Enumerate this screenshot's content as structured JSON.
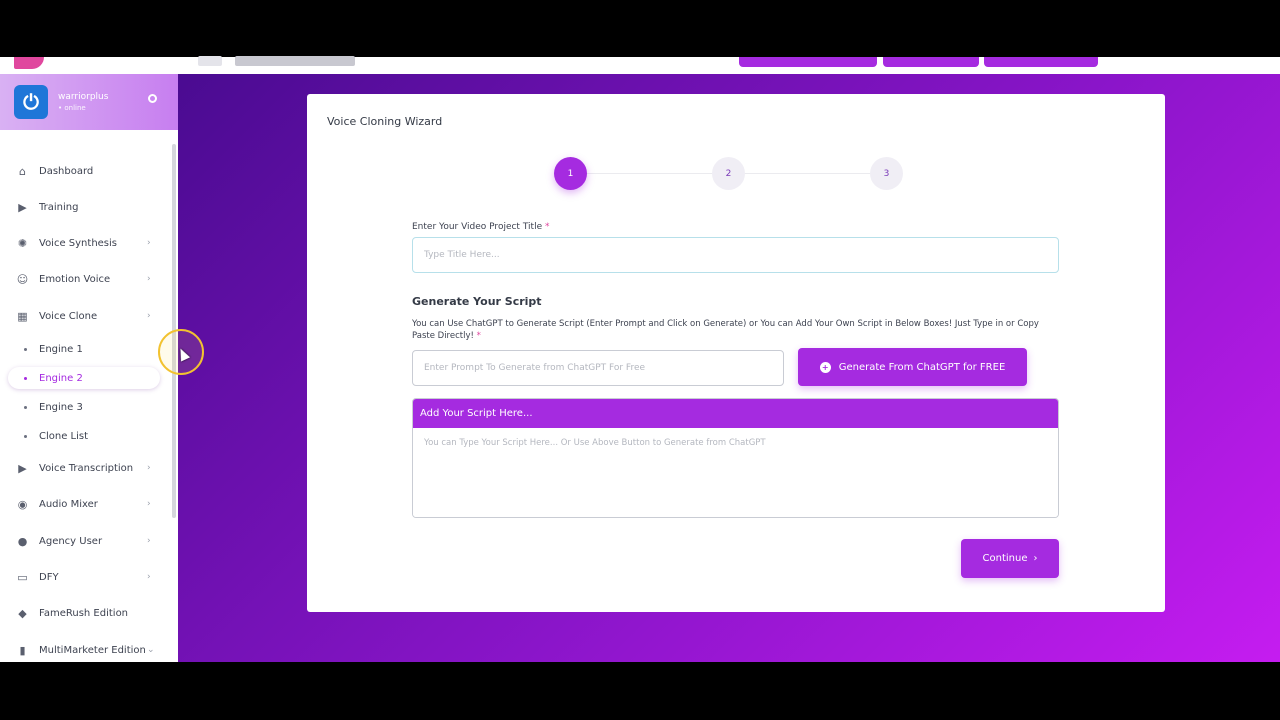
{
  "sidebar": {
    "profile": {
      "name": "warriorplus",
      "status": "• online"
    },
    "items": [
      {
        "label": "Dashboard",
        "icon": "home-icon",
        "chevron": false
      },
      {
        "label": "Training",
        "icon": "play-icon",
        "chevron": false
      },
      {
        "label": "Voice Synthesis",
        "icon": "waveform-icon",
        "chevron": true
      },
      {
        "label": "Emotion Voice",
        "icon": "smile-icon",
        "chevron": true
      },
      {
        "label": "Voice Clone",
        "icon": "grid-icon",
        "chevron": true
      },
      {
        "label": "Voice Transcription",
        "icon": "transcript-icon",
        "chevron": true
      },
      {
        "label": "Audio Mixer",
        "icon": "mixer-icon",
        "chevron": true
      },
      {
        "label": "Agency User",
        "icon": "user-icon",
        "chevron": true
      },
      {
        "label": "DFY",
        "icon": "monitor-icon",
        "chevron": true
      },
      {
        "label": "FameRush Edition",
        "icon": "diamond-icon",
        "chevron": false
      },
      {
        "label": "MultiMarketer Edition",
        "icon": "bars-icon",
        "chevron": true
      }
    ],
    "voice_clone_subitems": [
      {
        "label": "Engine 1",
        "active": false
      },
      {
        "label": "Engine 2",
        "active": true
      },
      {
        "label": "Engine 3",
        "active": false
      },
      {
        "label": "Clone List",
        "active": false
      }
    ]
  },
  "wizard": {
    "title": "Voice Cloning Wizard",
    "steps": [
      "1",
      "2",
      "3"
    ],
    "active_step": 1,
    "project_title_label": "Enter Your Video Project Title",
    "required_mark": "*",
    "project_title_placeholder": "Type Title Here...",
    "script_heading": "Generate Your Script",
    "script_description": "You can Use ChatGPT to Generate Script (Enter Prompt and Click on Generate) or You can Add Your Own Script in Below Boxes! Just Type in or Copy Paste Directly!",
    "prompt_placeholder": "Enter Prompt To Generate from ChatGPT For Free",
    "generate_button": "Generate From ChatGPT for FREE",
    "script_box_header": "Add Your Script Here...",
    "script_placeholder": "You can Type Your Script Here... Or Use Above Button to Generate from ChatGPT",
    "continue_button": "Continue"
  },
  "colors": {
    "accent": "#a52be0",
    "background_gradient_start": "#4a0b91",
    "background_gradient_end": "#c51cf0"
  }
}
